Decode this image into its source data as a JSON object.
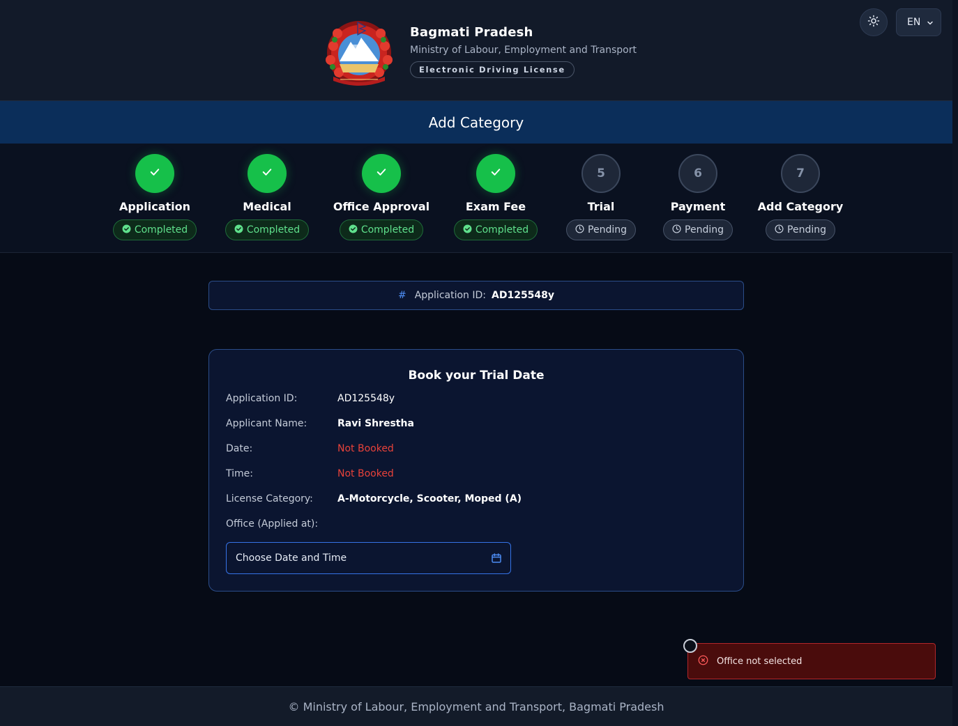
{
  "header": {
    "title": "Bagmati Pradesh",
    "subtitle": "Ministry of Labour, Employment and Transport",
    "badge": "Electronic Driving License",
    "language": "EN"
  },
  "section_title": "Add Category",
  "steps": [
    {
      "label": "Application",
      "status": "Completed",
      "state": "done"
    },
    {
      "label": "Medical",
      "status": "Completed",
      "state": "done"
    },
    {
      "label": "Office Approval",
      "status": "Completed",
      "state": "done"
    },
    {
      "label": "Exam Fee",
      "status": "Completed",
      "state": "done"
    },
    {
      "label": "Trial",
      "status": "Pending",
      "state": "pending",
      "number": "5"
    },
    {
      "label": "Payment",
      "status": "Pending",
      "state": "pending",
      "number": "6"
    },
    {
      "label": "Add Category",
      "status": "Pending",
      "state": "pending",
      "number": "7"
    }
  ],
  "application_banner": {
    "icon": "#",
    "label": "Application ID:",
    "value": "AD125548y"
  },
  "booking": {
    "title": "Book your Trial Date",
    "rows": [
      {
        "label": "Application ID:",
        "value": "AD125548y"
      },
      {
        "label": "Applicant Name:",
        "value": "Ravi Shrestha"
      },
      {
        "label": "Date:",
        "value": "Not Booked"
      },
      {
        "label": "Time:",
        "value": "Not Booked"
      },
      {
        "label": "License Category:",
        "value": "A-Motorcycle, Scooter, Moped (A)"
      },
      {
        "label": "Office (Applied at):",
        "value": ""
      }
    ],
    "picker_placeholder": "Choose Date and Time"
  },
  "toast": {
    "message": "Office not selected"
  },
  "footer": "© Ministry of Labour, Employment and Transport, Bagmati Pradesh",
  "colors": {
    "success": "#16c04a",
    "warning_text": "#e8423a",
    "accent": "#3573e8",
    "section_bar": "#0b2e5a"
  }
}
